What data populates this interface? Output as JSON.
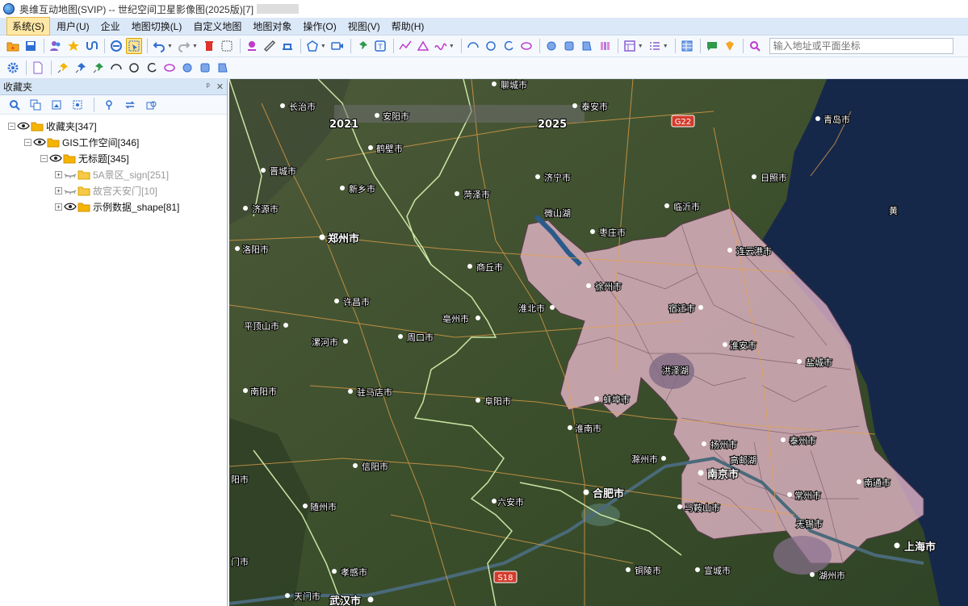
{
  "window": {
    "title": "奥维互动地图(SVIP) -- 世纪空间卫星影像图(2025版)[7]"
  },
  "menu": {
    "items": [
      {
        "label": "系统(S)"
      },
      {
        "label": "用户(U)"
      },
      {
        "label": "企业"
      },
      {
        "label": "地图切换(L)"
      },
      {
        "label": "自定义地图"
      },
      {
        "label": "地图对象"
      },
      {
        "label": "操作(O)"
      },
      {
        "label": "视图(V)"
      },
      {
        "label": "帮助(H)"
      }
    ]
  },
  "toolbar": {
    "search_placeholder": "输入地址或平面坐标"
  },
  "favorites_panel": {
    "title": "收藏夹",
    "pin_glyph": "ᵖ",
    "close_glyph": "✕",
    "tree": [
      {
        "label": "收藏夹[347]",
        "level": 0,
        "expander": "−",
        "dim": false
      },
      {
        "label": "GIS工作空间[346]",
        "level": 1,
        "expander": "−",
        "dim": false
      },
      {
        "label": "无标题[345]",
        "level": 2,
        "expander": "−",
        "dim": false
      },
      {
        "label": "5A景区_sign[251]",
        "level": 3,
        "expander": "+",
        "dim": true
      },
      {
        "label": "故宫天安门[10]",
        "level": 3,
        "expander": "+",
        "dim": true
      },
      {
        "label": "示例数据_shape[81]",
        "level": 3,
        "expander": "+",
        "dim": false
      }
    ]
  },
  "map": {
    "timeline_start": "2021",
    "timeline_end": "2025",
    "highway_shields": [
      "G22",
      "S18"
    ],
    "cities": [
      {
        "name": "长治市"
      },
      {
        "name": "安阳市"
      },
      {
        "name": "聊城市"
      },
      {
        "name": "泰安市"
      },
      {
        "name": "青岛市"
      },
      {
        "name": "鹤壁市"
      },
      {
        "name": "晋城市"
      },
      {
        "name": "新乡市"
      },
      {
        "name": "济宁市"
      },
      {
        "name": "日照市"
      },
      {
        "name": "济源市"
      },
      {
        "name": "菏泽市"
      },
      {
        "name": "临沂市"
      },
      {
        "name": "郑州市"
      },
      {
        "name": "枣庄市"
      },
      {
        "name": "洛阳市"
      },
      {
        "name": "商丘市"
      },
      {
        "name": "连云港市"
      },
      {
        "name": "徐州市"
      },
      {
        "name": "许昌市"
      },
      {
        "name": "亳州市"
      },
      {
        "name": "淮北市"
      },
      {
        "name": "宿迁市"
      },
      {
        "name": "平顶山市"
      },
      {
        "name": "漯河市"
      },
      {
        "name": "周口市"
      },
      {
        "name": "淮安市"
      },
      {
        "name": "盐城市"
      },
      {
        "name": "南阳市"
      },
      {
        "name": "驻马店市"
      },
      {
        "name": "阜阳市"
      },
      {
        "name": "蚌埠市"
      },
      {
        "name": "淮南市"
      },
      {
        "name": "扬州市"
      },
      {
        "name": "泰州市"
      },
      {
        "name": "滁州市"
      },
      {
        "name": "信阳市"
      },
      {
        "name": "南京市"
      },
      {
        "name": "合肥市"
      },
      {
        "name": "南通市"
      },
      {
        "name": "六安市"
      },
      {
        "name": "常州市"
      },
      {
        "name": "随州市"
      },
      {
        "name": "马鞍山市"
      },
      {
        "name": "无锡市"
      },
      {
        "name": "上海市"
      },
      {
        "name": "孝感市"
      },
      {
        "name": "铜陵市"
      },
      {
        "name": "宣城市"
      },
      {
        "name": "湖州市"
      },
      {
        "name": "天门市"
      },
      {
        "name": "武汉市"
      },
      {
        "name": "门市"
      },
      {
        "name": "阳市"
      }
    ],
    "water_labels": [
      "黄",
      "洪泽湖",
      "微山湖",
      "高邮湖"
    ],
    "region_color": "#e8b8cc",
    "sea_color": "#16284a"
  }
}
